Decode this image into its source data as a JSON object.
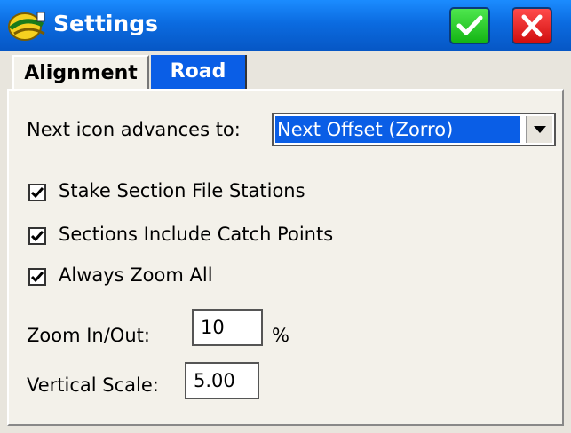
{
  "window": {
    "title": "Settings",
    "ok_icon": "checkmark-icon",
    "close_icon": "close-icon"
  },
  "tabs": [
    {
      "label": "Alignment",
      "active": false
    },
    {
      "label": "Road",
      "active": true
    }
  ],
  "next_icon": {
    "label": "Next icon advances to:",
    "selected": "Next Offset (Zorro)"
  },
  "checkboxes": [
    {
      "label": "Stake Section File Stations",
      "checked": true
    },
    {
      "label": "Sections Include Catch Points",
      "checked": true
    },
    {
      "label": "Always Zoom All",
      "checked": true
    }
  ],
  "zoom": {
    "label": "Zoom In/Out:",
    "value": "10",
    "unit": "%"
  },
  "vertical_scale": {
    "label": "Vertical Scale:",
    "value": "5.00"
  },
  "colors": {
    "titlebar": "#0b6be0",
    "selection": "#0a5ee6",
    "ok": "#14b514",
    "close": "#d10f0f"
  }
}
